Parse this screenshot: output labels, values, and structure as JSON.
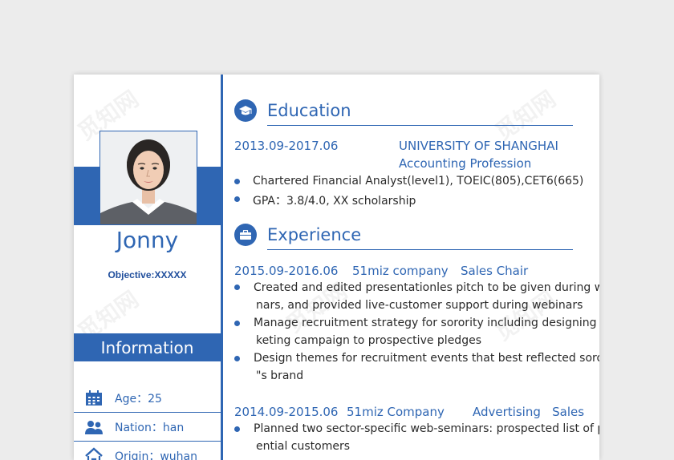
{
  "profile": {
    "name": "Jonny",
    "objective": "Objective:XXXXX"
  },
  "info": {
    "title": "Information",
    "items": [
      {
        "icon": "calendar-icon",
        "text": "Age：25"
      },
      {
        "icon": "people-icon",
        "text": "Nation：han"
      },
      {
        "icon": "home-icon",
        "text": "Origin：wuhan"
      }
    ]
  },
  "education": {
    "title": "Education",
    "date": "2013.09-2017.06",
    "school": "UNIVERSITY OF SHANGHAI",
    "major": "Accounting Profession",
    "bullets": [
      "Chartered Financial Analyst(level1), TOEIC(805),CET6(665)",
      "GPA：3.8/4.0, XX scholarship"
    ]
  },
  "experience": {
    "title": "Experience",
    "jobs": [
      {
        "date": "2015.09-2016.06",
        "company": "51miz company",
        "role": "Sales Chair",
        "bullets": [
          [
            "Created and edited presentationles pitch to be given during webi",
            "nars, and provided live-customer support during webinars"
          ],
          [
            "Manage recruitment strategy for sorority including designing mar",
            "keting campaign to prospective pledges"
          ],
          [
            "Design themes for recruitment events that best reflected sorority",
            "\"s brand"
          ]
        ]
      },
      {
        "date": "2014.09-2015.06",
        "company": "51miz Company",
        "role": "Advertising   Sales",
        "bullets": [
          [
            "Planned two sector-specific web-seminars: prospected list of pot",
            "ential customers"
          ]
        ]
      }
    ]
  },
  "watermark": "觅知网",
  "colors": {
    "accent": "#2f66b3"
  }
}
